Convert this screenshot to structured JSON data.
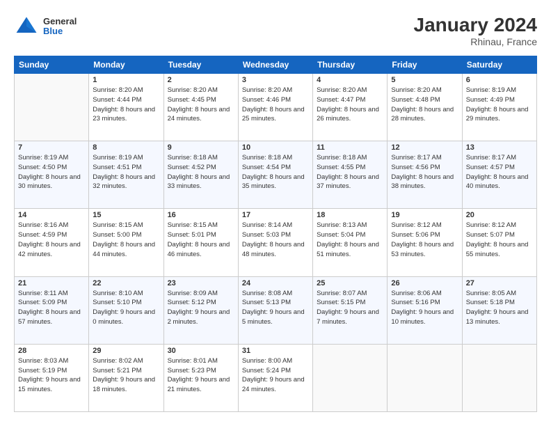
{
  "header": {
    "logo_general": "General",
    "logo_blue": "Blue",
    "title": "January 2024",
    "location": "Rhinau, France"
  },
  "weekdays": [
    "Sunday",
    "Monday",
    "Tuesday",
    "Wednesday",
    "Thursday",
    "Friday",
    "Saturday"
  ],
  "weeks": [
    [
      {
        "day": "",
        "sunrise": "",
        "sunset": "",
        "daylight": ""
      },
      {
        "day": "1",
        "sunrise": "Sunrise: 8:20 AM",
        "sunset": "Sunset: 4:44 PM",
        "daylight": "Daylight: 8 hours and 23 minutes."
      },
      {
        "day": "2",
        "sunrise": "Sunrise: 8:20 AM",
        "sunset": "Sunset: 4:45 PM",
        "daylight": "Daylight: 8 hours and 24 minutes."
      },
      {
        "day": "3",
        "sunrise": "Sunrise: 8:20 AM",
        "sunset": "Sunset: 4:46 PM",
        "daylight": "Daylight: 8 hours and 25 minutes."
      },
      {
        "day": "4",
        "sunrise": "Sunrise: 8:20 AM",
        "sunset": "Sunset: 4:47 PM",
        "daylight": "Daylight: 8 hours and 26 minutes."
      },
      {
        "day": "5",
        "sunrise": "Sunrise: 8:20 AM",
        "sunset": "Sunset: 4:48 PM",
        "daylight": "Daylight: 8 hours and 28 minutes."
      },
      {
        "day": "6",
        "sunrise": "Sunrise: 8:19 AM",
        "sunset": "Sunset: 4:49 PM",
        "daylight": "Daylight: 8 hours and 29 minutes."
      }
    ],
    [
      {
        "day": "7",
        "sunrise": "Sunrise: 8:19 AM",
        "sunset": "Sunset: 4:50 PM",
        "daylight": "Daylight: 8 hours and 30 minutes."
      },
      {
        "day": "8",
        "sunrise": "Sunrise: 8:19 AM",
        "sunset": "Sunset: 4:51 PM",
        "daylight": "Daylight: 8 hours and 32 minutes."
      },
      {
        "day": "9",
        "sunrise": "Sunrise: 8:18 AM",
        "sunset": "Sunset: 4:52 PM",
        "daylight": "Daylight: 8 hours and 33 minutes."
      },
      {
        "day": "10",
        "sunrise": "Sunrise: 8:18 AM",
        "sunset": "Sunset: 4:54 PM",
        "daylight": "Daylight: 8 hours and 35 minutes."
      },
      {
        "day": "11",
        "sunrise": "Sunrise: 8:18 AM",
        "sunset": "Sunset: 4:55 PM",
        "daylight": "Daylight: 8 hours and 37 minutes."
      },
      {
        "day": "12",
        "sunrise": "Sunrise: 8:17 AM",
        "sunset": "Sunset: 4:56 PM",
        "daylight": "Daylight: 8 hours and 38 minutes."
      },
      {
        "day": "13",
        "sunrise": "Sunrise: 8:17 AM",
        "sunset": "Sunset: 4:57 PM",
        "daylight": "Daylight: 8 hours and 40 minutes."
      }
    ],
    [
      {
        "day": "14",
        "sunrise": "Sunrise: 8:16 AM",
        "sunset": "Sunset: 4:59 PM",
        "daylight": "Daylight: 8 hours and 42 minutes."
      },
      {
        "day": "15",
        "sunrise": "Sunrise: 8:15 AM",
        "sunset": "Sunset: 5:00 PM",
        "daylight": "Daylight: 8 hours and 44 minutes."
      },
      {
        "day": "16",
        "sunrise": "Sunrise: 8:15 AM",
        "sunset": "Sunset: 5:01 PM",
        "daylight": "Daylight: 8 hours and 46 minutes."
      },
      {
        "day": "17",
        "sunrise": "Sunrise: 8:14 AM",
        "sunset": "Sunset: 5:03 PM",
        "daylight": "Daylight: 8 hours and 48 minutes."
      },
      {
        "day": "18",
        "sunrise": "Sunrise: 8:13 AM",
        "sunset": "Sunset: 5:04 PM",
        "daylight": "Daylight: 8 hours and 51 minutes."
      },
      {
        "day": "19",
        "sunrise": "Sunrise: 8:12 AM",
        "sunset": "Sunset: 5:06 PM",
        "daylight": "Daylight: 8 hours and 53 minutes."
      },
      {
        "day": "20",
        "sunrise": "Sunrise: 8:12 AM",
        "sunset": "Sunset: 5:07 PM",
        "daylight": "Daylight: 8 hours and 55 minutes."
      }
    ],
    [
      {
        "day": "21",
        "sunrise": "Sunrise: 8:11 AM",
        "sunset": "Sunset: 5:09 PM",
        "daylight": "Daylight: 8 hours and 57 minutes."
      },
      {
        "day": "22",
        "sunrise": "Sunrise: 8:10 AM",
        "sunset": "Sunset: 5:10 PM",
        "daylight": "Daylight: 9 hours and 0 minutes."
      },
      {
        "day": "23",
        "sunrise": "Sunrise: 8:09 AM",
        "sunset": "Sunset: 5:12 PM",
        "daylight": "Daylight: 9 hours and 2 minutes."
      },
      {
        "day": "24",
        "sunrise": "Sunrise: 8:08 AM",
        "sunset": "Sunset: 5:13 PM",
        "daylight": "Daylight: 9 hours and 5 minutes."
      },
      {
        "day": "25",
        "sunrise": "Sunrise: 8:07 AM",
        "sunset": "Sunset: 5:15 PM",
        "daylight": "Daylight: 9 hours and 7 minutes."
      },
      {
        "day": "26",
        "sunrise": "Sunrise: 8:06 AM",
        "sunset": "Sunset: 5:16 PM",
        "daylight": "Daylight: 9 hours and 10 minutes."
      },
      {
        "day": "27",
        "sunrise": "Sunrise: 8:05 AM",
        "sunset": "Sunset: 5:18 PM",
        "daylight": "Daylight: 9 hours and 13 minutes."
      }
    ],
    [
      {
        "day": "28",
        "sunrise": "Sunrise: 8:03 AM",
        "sunset": "Sunset: 5:19 PM",
        "daylight": "Daylight: 9 hours and 15 minutes."
      },
      {
        "day": "29",
        "sunrise": "Sunrise: 8:02 AM",
        "sunset": "Sunset: 5:21 PM",
        "daylight": "Daylight: 9 hours and 18 minutes."
      },
      {
        "day": "30",
        "sunrise": "Sunrise: 8:01 AM",
        "sunset": "Sunset: 5:23 PM",
        "daylight": "Daylight: 9 hours and 21 minutes."
      },
      {
        "day": "31",
        "sunrise": "Sunrise: 8:00 AM",
        "sunset": "Sunset: 5:24 PM",
        "daylight": "Daylight: 9 hours and 24 minutes."
      },
      {
        "day": "",
        "sunrise": "",
        "sunset": "",
        "daylight": ""
      },
      {
        "day": "",
        "sunrise": "",
        "sunset": "",
        "daylight": ""
      },
      {
        "day": "",
        "sunrise": "",
        "sunset": "",
        "daylight": ""
      }
    ]
  ]
}
